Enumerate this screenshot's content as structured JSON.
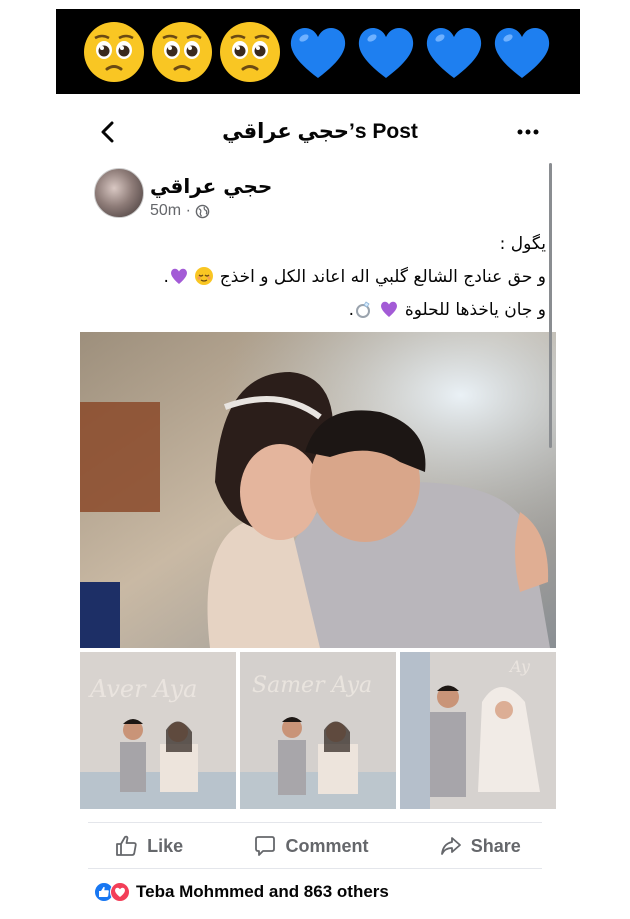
{
  "banner": {
    "emojis": [
      "pleading-face",
      "pleading-face",
      "pleading-face",
      "blue-heart",
      "blue-heart",
      "blue-heart",
      "blue-heart"
    ]
  },
  "navbar": {
    "title": "حجي عراقي’s Post",
    "back_icon": "chevron-left-icon",
    "more_icon": "more-horizontal-icon"
  },
  "post": {
    "author": "حجي عراقي",
    "time": "50m ·",
    "audience_icon": "globe-icon",
    "text_lines": [
      "يگول :",
      "و حق عنادج الشالع گلبي اله اعاند الكل و اخذج",
      "و جان ياخذها للحلوة"
    ],
    "line_end_1": ".",
    "line_end_2": "."
  },
  "actions": {
    "like": "Like",
    "comment": "Comment",
    "share": "Share"
  },
  "reactions": {
    "summary": "Teba Mohmmed and 863 others",
    "icons": [
      "like-reaction-icon",
      "love-reaction-icon"
    ]
  },
  "colors": {
    "blue_heart": "#1e7ff0",
    "purple_heart": "#a35bd6",
    "like_blue": "#1877f2",
    "love_red": "#f33e58",
    "secondary_text": "#65676b"
  }
}
